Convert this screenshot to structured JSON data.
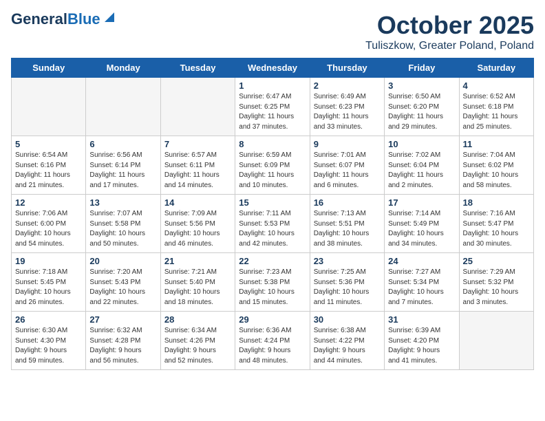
{
  "logo": {
    "line1": "General",
    "line2": "Blue"
  },
  "title": "October 2025",
  "location": "Tuliszkow, Greater Poland, Poland",
  "weekdays": [
    "Sunday",
    "Monday",
    "Tuesday",
    "Wednesday",
    "Thursday",
    "Friday",
    "Saturday"
  ],
  "weeks": [
    [
      {
        "day": "",
        "info": ""
      },
      {
        "day": "",
        "info": ""
      },
      {
        "day": "",
        "info": ""
      },
      {
        "day": "1",
        "info": "Sunrise: 6:47 AM\nSunset: 6:25 PM\nDaylight: 11 hours\nand 37 minutes."
      },
      {
        "day": "2",
        "info": "Sunrise: 6:49 AM\nSunset: 6:23 PM\nDaylight: 11 hours\nand 33 minutes."
      },
      {
        "day": "3",
        "info": "Sunrise: 6:50 AM\nSunset: 6:20 PM\nDaylight: 11 hours\nand 29 minutes."
      },
      {
        "day": "4",
        "info": "Sunrise: 6:52 AM\nSunset: 6:18 PM\nDaylight: 11 hours\nand 25 minutes."
      }
    ],
    [
      {
        "day": "5",
        "info": "Sunrise: 6:54 AM\nSunset: 6:16 PM\nDaylight: 11 hours\nand 21 minutes."
      },
      {
        "day": "6",
        "info": "Sunrise: 6:56 AM\nSunset: 6:14 PM\nDaylight: 11 hours\nand 17 minutes."
      },
      {
        "day": "7",
        "info": "Sunrise: 6:57 AM\nSunset: 6:11 PM\nDaylight: 11 hours\nand 14 minutes."
      },
      {
        "day": "8",
        "info": "Sunrise: 6:59 AM\nSunset: 6:09 PM\nDaylight: 11 hours\nand 10 minutes."
      },
      {
        "day": "9",
        "info": "Sunrise: 7:01 AM\nSunset: 6:07 PM\nDaylight: 11 hours\nand 6 minutes."
      },
      {
        "day": "10",
        "info": "Sunrise: 7:02 AM\nSunset: 6:04 PM\nDaylight: 11 hours\nand 2 minutes."
      },
      {
        "day": "11",
        "info": "Sunrise: 7:04 AM\nSunset: 6:02 PM\nDaylight: 10 hours\nand 58 minutes."
      }
    ],
    [
      {
        "day": "12",
        "info": "Sunrise: 7:06 AM\nSunset: 6:00 PM\nDaylight: 10 hours\nand 54 minutes."
      },
      {
        "day": "13",
        "info": "Sunrise: 7:07 AM\nSunset: 5:58 PM\nDaylight: 10 hours\nand 50 minutes."
      },
      {
        "day": "14",
        "info": "Sunrise: 7:09 AM\nSunset: 5:56 PM\nDaylight: 10 hours\nand 46 minutes."
      },
      {
        "day": "15",
        "info": "Sunrise: 7:11 AM\nSunset: 5:53 PM\nDaylight: 10 hours\nand 42 minutes."
      },
      {
        "day": "16",
        "info": "Sunrise: 7:13 AM\nSunset: 5:51 PM\nDaylight: 10 hours\nand 38 minutes."
      },
      {
        "day": "17",
        "info": "Sunrise: 7:14 AM\nSunset: 5:49 PM\nDaylight: 10 hours\nand 34 minutes."
      },
      {
        "day": "18",
        "info": "Sunrise: 7:16 AM\nSunset: 5:47 PM\nDaylight: 10 hours\nand 30 minutes."
      }
    ],
    [
      {
        "day": "19",
        "info": "Sunrise: 7:18 AM\nSunset: 5:45 PM\nDaylight: 10 hours\nand 26 minutes."
      },
      {
        "day": "20",
        "info": "Sunrise: 7:20 AM\nSunset: 5:43 PM\nDaylight: 10 hours\nand 22 minutes."
      },
      {
        "day": "21",
        "info": "Sunrise: 7:21 AM\nSunset: 5:40 PM\nDaylight: 10 hours\nand 18 minutes."
      },
      {
        "day": "22",
        "info": "Sunrise: 7:23 AM\nSunset: 5:38 PM\nDaylight: 10 hours\nand 15 minutes."
      },
      {
        "day": "23",
        "info": "Sunrise: 7:25 AM\nSunset: 5:36 PM\nDaylight: 10 hours\nand 11 minutes."
      },
      {
        "day": "24",
        "info": "Sunrise: 7:27 AM\nSunset: 5:34 PM\nDaylight: 10 hours\nand 7 minutes."
      },
      {
        "day": "25",
        "info": "Sunrise: 7:29 AM\nSunset: 5:32 PM\nDaylight: 10 hours\nand 3 minutes."
      }
    ],
    [
      {
        "day": "26",
        "info": "Sunrise: 6:30 AM\nSunset: 4:30 PM\nDaylight: 9 hours\nand 59 minutes."
      },
      {
        "day": "27",
        "info": "Sunrise: 6:32 AM\nSunset: 4:28 PM\nDaylight: 9 hours\nand 56 minutes."
      },
      {
        "day": "28",
        "info": "Sunrise: 6:34 AM\nSunset: 4:26 PM\nDaylight: 9 hours\nand 52 minutes."
      },
      {
        "day": "29",
        "info": "Sunrise: 6:36 AM\nSunset: 4:24 PM\nDaylight: 9 hours\nand 48 minutes."
      },
      {
        "day": "30",
        "info": "Sunrise: 6:38 AM\nSunset: 4:22 PM\nDaylight: 9 hours\nand 44 minutes."
      },
      {
        "day": "31",
        "info": "Sunrise: 6:39 AM\nSunset: 4:20 PM\nDaylight: 9 hours\nand 41 minutes."
      },
      {
        "day": "",
        "info": ""
      }
    ]
  ]
}
